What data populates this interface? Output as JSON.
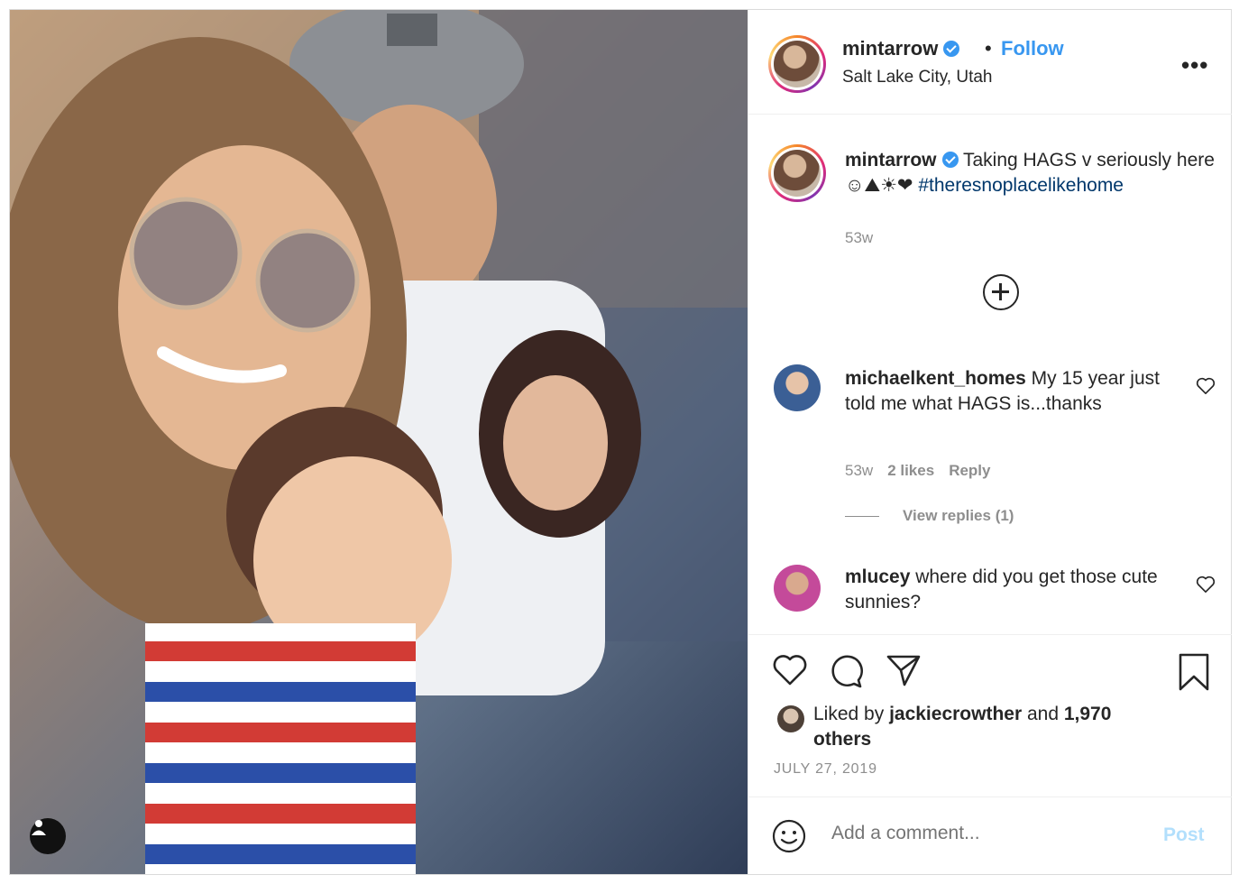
{
  "post": {
    "username": "mintarrow",
    "follow_label": "Follow",
    "separator": "•",
    "location": "Salt Lake City, Utah",
    "more_label": "•••"
  },
  "caption": {
    "username": "mintarrow",
    "text": " Taking HAGS v seriously here ☺⛰☀❤ ",
    "hashtag": "#theresnoplacelikehome",
    "time": "53w"
  },
  "comments": [
    {
      "username": "michaelkent_homes",
      "text": " My 15 year just told me what HAGS is...thanks",
      "time": "53w",
      "likes": "2 likes",
      "reply": "Reply",
      "view_replies": "View replies (1)"
    },
    {
      "username": "mlucey",
      "text": " where did you get those cute sunnies?"
    }
  ],
  "likes": {
    "prefix": "Liked by ",
    "user": "jackiecrowther",
    "middle": " and ",
    "others": "1,970 others"
  },
  "date": "JULY 27, 2019",
  "add_comment": {
    "placeholder": "Add a comment...",
    "post_label": "Post"
  },
  "colors": {
    "accent": "#3897f0",
    "hashtag": "#00376b",
    "muted": "#8e8e8e",
    "post_disabled": "#b2dffc"
  },
  "icons": [
    "heart-icon",
    "comment-icon",
    "share-icon",
    "bookmark-icon",
    "emoji-icon",
    "user-tag-icon",
    "plus-circle-icon",
    "verified-badge-icon"
  ]
}
